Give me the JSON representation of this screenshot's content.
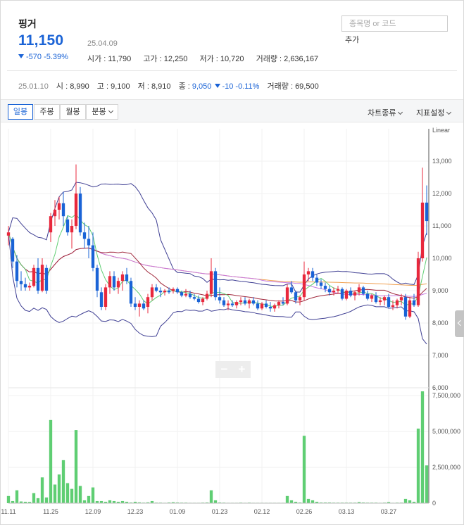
{
  "stock": {
    "name": "핑거",
    "price": "11,150",
    "date": "25.04.09",
    "change": "-570 -5.39%",
    "open_label": "시가",
    "open": "11,790",
    "high_label": "고가",
    "high": "12,250",
    "low_label": "저가",
    "low": "10,720",
    "volume_label": "거래량",
    "volume": "2,636,167"
  },
  "search": {
    "placeholder": "종목명 or 코드",
    "add_label": "추가"
  },
  "hover": {
    "date": "25.01.10",
    "open_label": "시",
    "open": "8,990",
    "high_label": "고",
    "high": "9,100",
    "low_label": "저",
    "low": "8,910",
    "close_label": "종",
    "close": "9,050",
    "change": "-10 -0.11%",
    "volume_label": "거래량",
    "volume": "69,500"
  },
  "toolbar": {
    "periods": [
      "일봉",
      "주봉",
      "월봉",
      "분봉"
    ],
    "active_period": "일봉",
    "chart_type": "차트종류",
    "indicator_settings": "지표설정"
  },
  "zoom": {
    "minus": "−",
    "plus": "+"
  },
  "colors": {
    "up": "#e8283c",
    "down": "#1a63d6",
    "volume": "#5fce73",
    "bollinger": "#3f3f93",
    "ma5": "#5fce73",
    "ma20": "#a0283c",
    "ma60": "#c679e0",
    "ma120": "#f0a050"
  },
  "chart_data": {
    "type": "candlestick",
    "scale_label": "Linear",
    "price_axis": {
      "ylim": [
        6000,
        14000
      ],
      "ticks": [
        "13,000",
        "12,000",
        "11,000",
        "10,000",
        "9,000",
        "8,000",
        "7,000",
        "6,000"
      ]
    },
    "volume_axis": {
      "ylim": [
        0,
        8000000
      ],
      "ticks": [
        "7,500,000",
        "5,000,000",
        "2,500,000",
        "0"
      ]
    },
    "x_ticks": [
      "11.11",
      "11.25",
      "12.09",
      "12.23",
      "01.09",
      "01.23",
      "02.12",
      "02.26",
      "03.13",
      "03.27"
    ],
    "x_tick_index": [
      0,
      10,
      20,
      30,
      40,
      50,
      60,
      70,
      80,
      90
    ],
    "candles": [
      [
        10700,
        11000,
        10400,
        10800,
        500000
      ],
      [
        10600,
        10650,
        9700,
        9900,
        150000
      ],
      [
        9900,
        10100,
        9100,
        9300,
        900000
      ],
      [
        9300,
        9600,
        9000,
        9200,
        120000
      ],
      [
        9200,
        9400,
        9000,
        9100,
        100000
      ],
      [
        9100,
        9250,
        9000,
        9150,
        90000
      ],
      [
        9150,
        9800,
        9100,
        9700,
        700000
      ],
      [
        9700,
        10000,
        8900,
        9000,
        350000
      ],
      [
        9000,
        10000,
        8950,
        9800,
        1800000
      ],
      [
        9700,
        9800,
        8900,
        9000,
        400000
      ],
      [
        10800,
        11400,
        10500,
        11300,
        5800000
      ],
      [
        11300,
        11800,
        11000,
        11500,
        1300000
      ],
      [
        11500,
        11900,
        11200,
        11700,
        2000000
      ],
      [
        11700,
        12050,
        11000,
        11300,
        3000000
      ],
      [
        11200,
        11300,
        10700,
        10800,
        1400000
      ],
      [
        10800,
        11200,
        10300,
        11000,
        1000000
      ],
      [
        11000,
        12900,
        10900,
        12000,
        5100000
      ],
      [
        12000,
        12200,
        10700,
        10800,
        1200000
      ],
      [
        10800,
        11100,
        10300,
        10600,
        200000
      ],
      [
        10600,
        11000,
        10000,
        10400,
        500000
      ],
      [
        10400,
        10800,
        9600,
        9700,
        1100000
      ],
      [
        9700,
        9800,
        8800,
        9000,
        150000
      ],
      [
        8950,
        9100,
        8400,
        8500,
        150000
      ],
      [
        8500,
        9200,
        8400,
        9100,
        100000
      ],
      [
        9100,
        9600,
        8900,
        9450,
        200000
      ],
      [
        9450,
        9600,
        9000,
        9100,
        150000
      ],
      [
        9100,
        9400,
        8900,
        9300,
        100000
      ],
      [
        9300,
        9600,
        9000,
        9500,
        150000
      ],
      [
        9500,
        9700,
        9200,
        9300,
        100000
      ],
      [
        9300,
        9400,
        8500,
        8600,
        50000
      ],
      [
        8600,
        8800,
        8400,
        8500,
        100000
      ],
      [
        8500,
        8700,
        8200,
        8600,
        60000
      ],
      [
        8600,
        8700,
        8400,
        8450,
        40000
      ],
      [
        8500,
        8900,
        8300,
        8800,
        60000
      ],
      [
        8800,
        9200,
        8700,
        9100,
        150000
      ],
      [
        9100,
        9200,
        8950,
        9000,
        40000
      ],
      [
        9000,
        9100,
        8800,
        8950,
        40000
      ],
      [
        8950,
        9050,
        8850,
        9000,
        30000
      ],
      [
        9000,
        9100,
        8900,
        8950,
        50000
      ],
      [
        8990,
        9100,
        8910,
        9050,
        69500
      ],
      [
        9050,
        9100,
        8900,
        8950,
        50000
      ],
      [
        8950,
        9000,
        8800,
        8850,
        40000
      ],
      [
        8850,
        9050,
        8800,
        8900,
        40000
      ],
      [
        8900,
        9000,
        8750,
        8800,
        30000
      ],
      [
        8800,
        8900,
        8700,
        8750,
        30000
      ],
      [
        8750,
        8850,
        8600,
        8650,
        30000
      ],
      [
        8650,
        8800,
        8550,
        8750,
        40000
      ],
      [
        8750,
        9000,
        8700,
        8900,
        50000
      ],
      [
        8900,
        10000,
        8800,
        9600,
        900000
      ],
      [
        9600,
        9700,
        8700,
        8800,
        200000
      ],
      [
        8800,
        9100,
        8600,
        8700,
        50000
      ],
      [
        8700,
        8800,
        8500,
        8550,
        40000
      ],
      [
        8550,
        8700,
        8400,
        8600,
        30000
      ],
      [
        8600,
        8700,
        8500,
        8550,
        30000
      ],
      [
        8550,
        8700,
        8450,
        8650,
        30000
      ],
      [
        8650,
        8800,
        8550,
        8700,
        40000
      ],
      [
        8700,
        8800,
        8550,
        8600,
        30000
      ],
      [
        8600,
        8750,
        8450,
        8700,
        40000
      ],
      [
        8700,
        8800,
        8550,
        8600,
        30000
      ],
      [
        8600,
        8700,
        8400,
        8450,
        30000
      ],
      [
        8450,
        8650,
        8400,
        8600,
        30000
      ],
      [
        8600,
        8700,
        8450,
        8500,
        30000
      ],
      [
        8500,
        8650,
        8350,
        8450,
        30000
      ],
      [
        8450,
        8600,
        8350,
        8550,
        30000
      ],
      [
        8550,
        8700,
        8450,
        8650,
        30000
      ],
      [
        8650,
        8800,
        8550,
        8600,
        30000
      ],
      [
        8600,
        9200,
        8550,
        9100,
        500000
      ],
      [
        9100,
        9300,
        8900,
        8950,
        200000
      ],
      [
        8950,
        9000,
        8600,
        8700,
        100000
      ],
      [
        8700,
        8850,
        8550,
        8800,
        50000
      ],
      [
        8800,
        9900,
        8700,
        9500,
        4700000
      ],
      [
        9500,
        9700,
        9300,
        9600,
        300000
      ],
      [
        9600,
        9700,
        9300,
        9400,
        200000
      ],
      [
        9400,
        9500,
        9150,
        9250,
        100000
      ],
      [
        9250,
        9350,
        9050,
        9150,
        50000
      ],
      [
        9150,
        9250,
        8950,
        9050,
        50000
      ],
      [
        9050,
        9150,
        8850,
        8950,
        50000
      ],
      [
        8950,
        9100,
        8850,
        9000,
        40000
      ],
      [
        9000,
        9150,
        8900,
        9050,
        40000
      ],
      [
        9050,
        9100,
        8700,
        8750,
        40000
      ],
      [
        8750,
        9050,
        8700,
        9000,
        40000
      ],
      [
        9000,
        9100,
        8800,
        8850,
        40000
      ],
      [
        8850,
        9000,
        8700,
        8950,
        40000
      ],
      [
        8950,
        9200,
        8850,
        9100,
        80000
      ],
      [
        9100,
        9150,
        8850,
        8900,
        50000
      ],
      [
        8900,
        9000,
        8700,
        8750,
        40000
      ],
      [
        8750,
        8900,
        8650,
        8850,
        40000
      ],
      [
        8850,
        8950,
        8600,
        8650,
        40000
      ],
      [
        8650,
        8800,
        8550,
        8700,
        30000
      ],
      [
        8700,
        8850,
        8550,
        8800,
        40000
      ],
      [
        8800,
        8900,
        8450,
        8500,
        80000
      ],
      [
        8500,
        8700,
        8400,
        8550,
        30000
      ],
      [
        8550,
        8750,
        8450,
        8700,
        40000
      ],
      [
        8700,
        8900,
        8550,
        8800,
        40000
      ],
      [
        8800,
        8900,
        8100,
        8200,
        300000
      ],
      [
        8200,
        8800,
        8150,
        8700,
        200000
      ],
      [
        8700,
        8900,
        8500,
        8550,
        100000
      ],
      [
        8550,
        10200,
        8500,
        10000,
        5200000
      ],
      [
        10000,
        12800,
        9900,
        11720,
        7800000
      ],
      [
        11720,
        12250,
        10720,
        11150,
        2636167
      ]
    ]
  }
}
